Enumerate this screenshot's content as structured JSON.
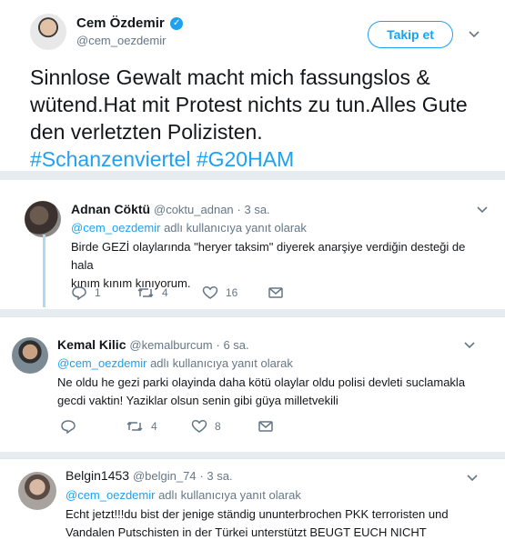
{
  "main_tweet": {
    "author_name": "Cem Özdemir",
    "author_handle": "@cem_oezdemir",
    "follow_label": "Takip et",
    "text": "Sinnlose Gewalt macht mich fassungslos & wütend.Hat mit Protest nichts zu tun.Alles Gute den verletzten Polizisten.",
    "hashtags": "#Schanzenviertel #G20HAM"
  },
  "replies": [
    {
      "name": "Adnan Cöktü",
      "handle": "@coktu_adnan",
      "time": "· 3 sa.",
      "reply_mention": "@cem_oezdemir",
      "reply_suffix": "adlı kullanıcıya yanıt olarak",
      "text_line1": "Birde GEZİ olaylarında \"heryer taksim\" diyerek anarşiye verdiğin desteği de hala",
      "text_line2": "kınım kınım kınıyorum.",
      "replies_count": "1",
      "retweets_count": "4",
      "likes_count": "16"
    },
    {
      "name": "Kemal Kilic",
      "handle": "@kemalburcum",
      "time": "· 6 sa.",
      "reply_mention": "@cem_oezdemir",
      "reply_suffix": "adlı kullanıcıya yanıt olarak",
      "text_line1": "Ne oldu he gezi parki olayinda daha kötü olaylar oldu polisi devleti suclamakla",
      "text_line2": "gecdi vaktin! Yaziklar olsun senin gibi güya milletvekili",
      "replies_count": "",
      "retweets_count": "4",
      "likes_count": "8"
    },
    {
      "name": "Belgin1453",
      "handle": "@belgin_74",
      "time": "· 3 sa.",
      "reply_mention": "@cem_oezdemir",
      "reply_suffix": "adlı kullanıcıya yanıt olarak",
      "text_line1": "Echt jetzt!!!du bist der jenige ständig ununterbrochen PKK terroristen und",
      "text_line2": "Vandalen Putschisten in der Türkei unterstützt BEUGT EUCH NICHT"
    }
  ],
  "colors": {
    "accent": "#1da1f2",
    "muted": "#657786",
    "text": "#14171a",
    "background": "#e6ecf0"
  },
  "icons": [
    "verified-badge-icon",
    "chevron-down-icon",
    "reply-icon",
    "retweet-icon",
    "like-icon",
    "message-icon"
  ]
}
